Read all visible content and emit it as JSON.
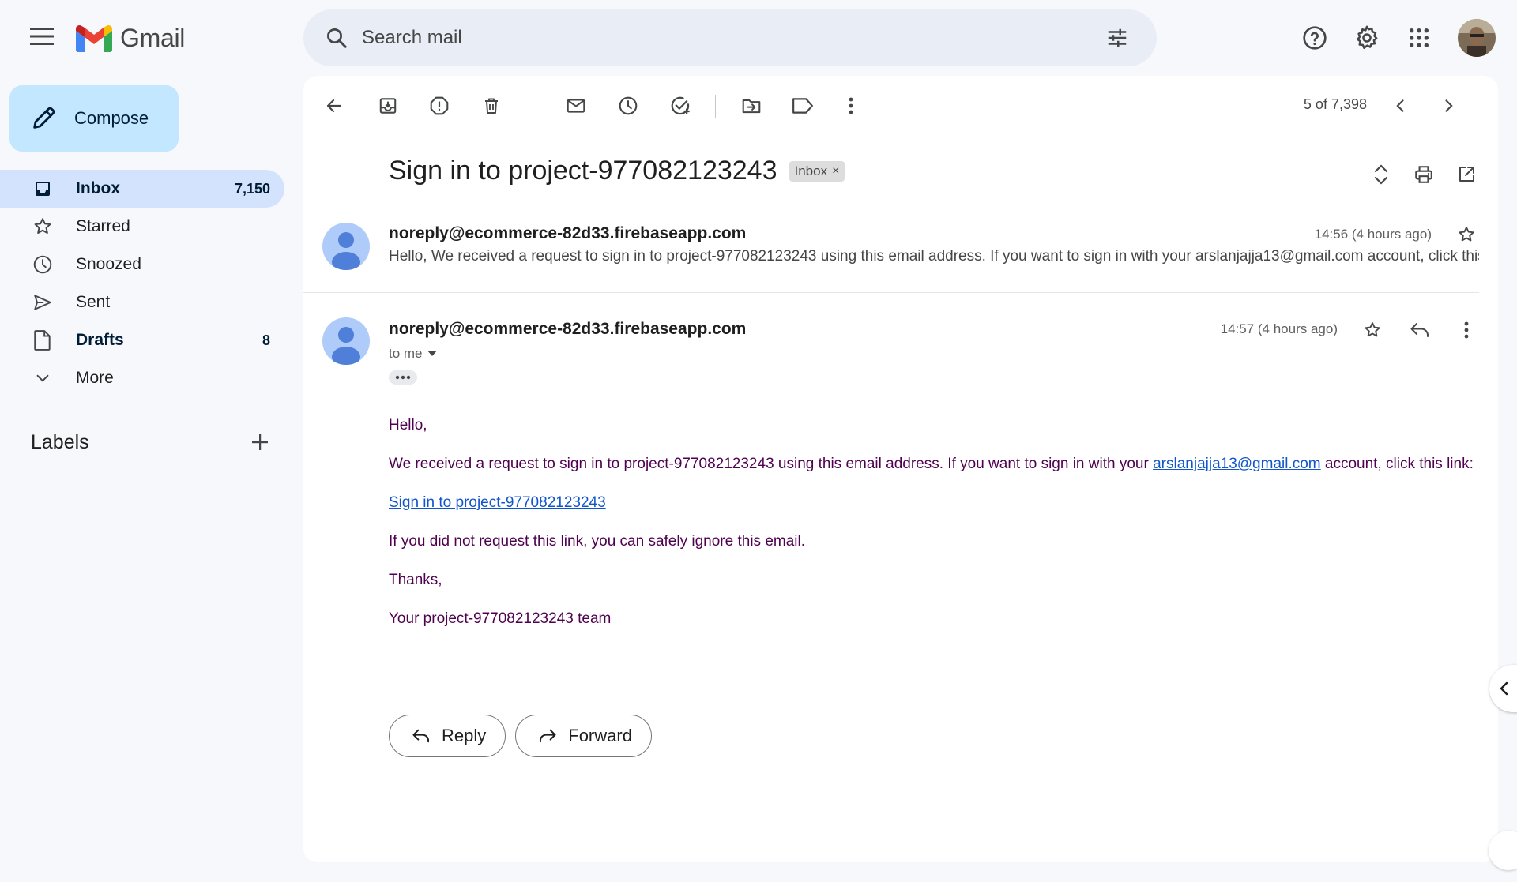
{
  "app": {
    "name": "Gmail"
  },
  "search": {
    "placeholder": "Search mail"
  },
  "sidebar": {
    "compose_label": "Compose",
    "items": [
      {
        "label": "Inbox",
        "count": "7,150",
        "icon": "inbox-icon"
      },
      {
        "label": "Starred",
        "count": "",
        "icon": "star-icon"
      },
      {
        "label": "Snoozed",
        "count": "",
        "icon": "clock-icon"
      },
      {
        "label": "Sent",
        "count": "",
        "icon": "send-icon"
      },
      {
        "label": "Drafts",
        "count": "8",
        "icon": "draft-icon"
      },
      {
        "label": "More",
        "count": "",
        "icon": "chevron-down-icon"
      }
    ],
    "labels_title": "Labels"
  },
  "toolbar": {
    "pager": "5 of 7,398",
    "icons": [
      "back-arrow-icon",
      "archive-icon",
      "report-spam-icon",
      "delete-icon",
      "mark-unread-icon",
      "snooze-icon",
      "add-to-tasks-icon",
      "move-to-icon",
      "label-icon",
      "more-vert-icon",
      "chevron-left-icon",
      "chevron-right-icon"
    ]
  },
  "thread": {
    "subject": "Sign in to project-977082123243",
    "label_chip": "Inbox",
    "messages": [
      {
        "sender": "noreply@ecommerce-82d33.firebaseapp.com",
        "time": "14:56 (4 hours ago)",
        "snippet": "Hello, We received a request to sign in to project-977082123243 using this email address. If you want to sign in with your arslanjajja13@gmail.com account, click this link:"
      },
      {
        "sender": "noreply@ecommerce-82d33.firebaseapp.com",
        "time": "14:57 (4 hours ago)",
        "recipient": "to me",
        "body": {
          "greeting": "Hello,",
          "para1_before": "We received a request to sign in to project-977082123243 using this email address. If you want to sign in with your ",
          "para1_link": "arslanjajja13@gmail.com",
          "para1_after": " account, click this link:",
          "signin_link": "Sign in to project-977082123243",
          "para2": "If you did not request this link, you can safely ignore this email.",
          "thanks": "Thanks,",
          "signature": "Your project-977082123243 team"
        }
      }
    ],
    "reply_label": "Reply",
    "forward_label": "Forward"
  },
  "colors": {
    "accent": "#c2e7ff",
    "active_nav": "#d3e3fd",
    "body_text": "#500050",
    "link": "#1155cc"
  }
}
